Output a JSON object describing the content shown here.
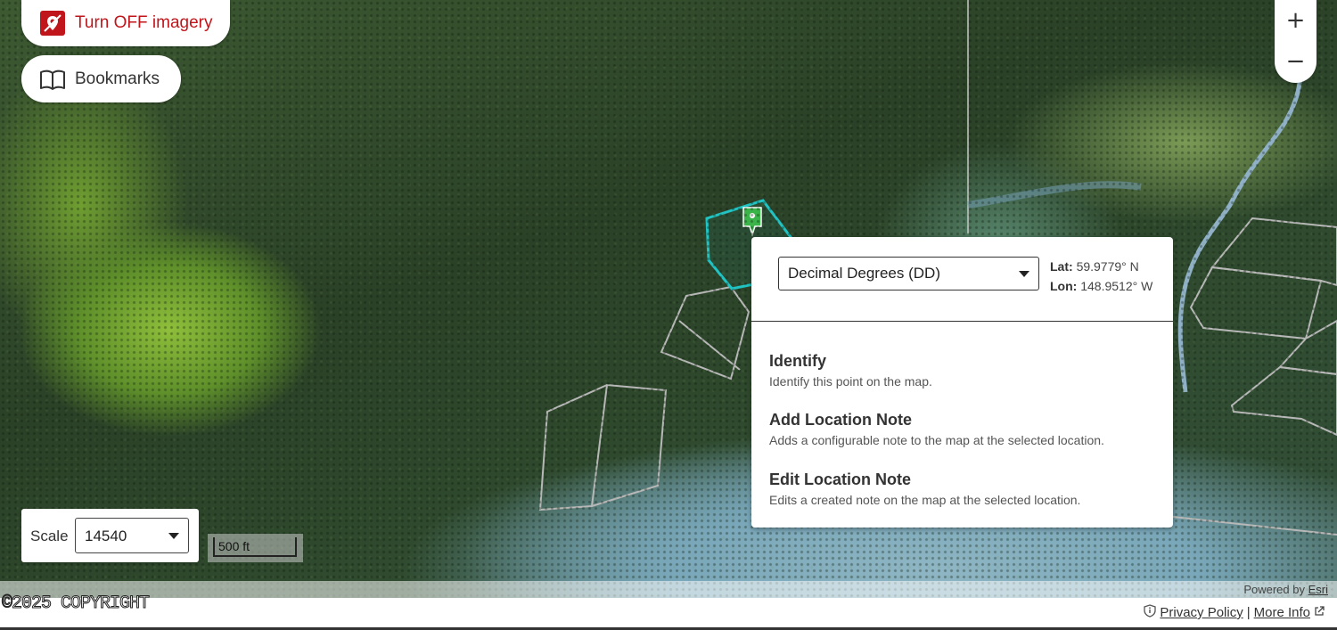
{
  "imagery_toggle": {
    "label": "Turn OFF imagery",
    "icon": "imagery-off-icon",
    "color": "#c0151b"
  },
  "bookmarks": {
    "label": "Bookmarks",
    "icon": "book-icon"
  },
  "zoom": {
    "in_label": "+",
    "out_label": "−"
  },
  "popup": {
    "coordinate_format": "Decimal Degrees (DD)",
    "lat_label": "Lat:",
    "lat_value": "59.9779° N",
    "lon_label": "Lon:",
    "lon_value": "148.9512° W",
    "actions": [
      {
        "title": "Identify",
        "description": "Identify this point on the map."
      },
      {
        "title": "Add Location Note",
        "description": "Adds a configurable note to the map at the selected location."
      },
      {
        "title": "Edit Location Note",
        "description": "Edits a created note on the map at the selected location."
      }
    ]
  },
  "scale": {
    "label": "Scale",
    "value": "14540"
  },
  "scalebar": {
    "text": "500 ft"
  },
  "attribution": {
    "prefix": "Powered by",
    "link": "Esri"
  },
  "footer": {
    "copyright": "©2025 COPYRIGHT",
    "privacy": "Privacy Policy",
    "separator": "|",
    "more_info": "More Info"
  },
  "colors": {
    "selection_outline": "#20c4c4",
    "marker": "#3bb54a",
    "parcel_lines": "#b8b8b8"
  }
}
